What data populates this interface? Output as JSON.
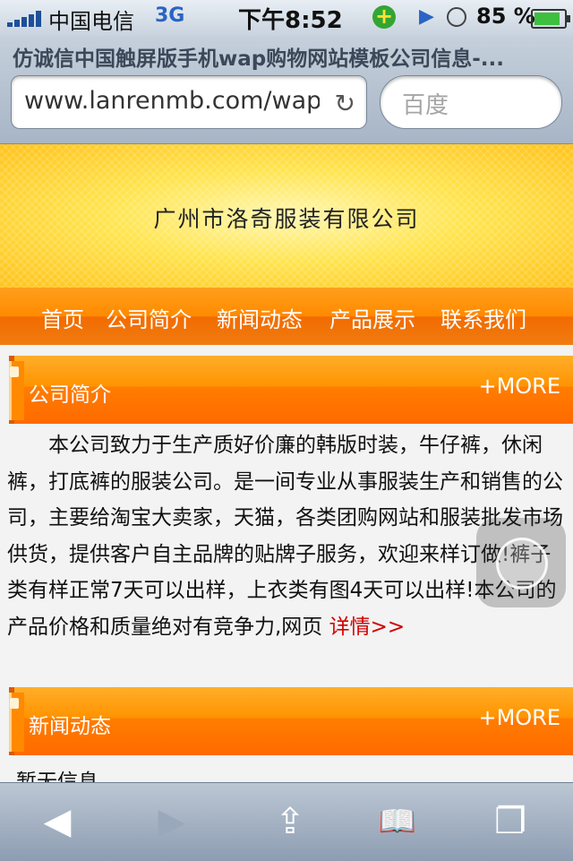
{
  "status_bar": {
    "carrier": "中国电信",
    "network": "3G",
    "time": "下午8:52",
    "battery": "85 %"
  },
  "browser": {
    "page_title": "仿诚信中国触屏版手机wap购物网站模板公司信息-...",
    "url": "www.lanrenmb.com/wap",
    "search_placeholder": "百度"
  },
  "banner": {
    "company_name": "广州市洛奇服装有限公司"
  },
  "nav": {
    "items": [
      "首页",
      "公司简介",
      "新闻动态",
      "产品展示",
      "联系我们"
    ]
  },
  "sections": {
    "about": {
      "title": "公司简介",
      "more": "+MORE",
      "text": "本公司致力于生产质好价廉的韩版时装，牛仔裤，休闲裤，打底裤的服装公司。是一间专业从事服装生产和销售的公司，主要给淘宝大卖家，天猫，各类团购网站和服装批发市场供货，提供客户自主品牌的贴牌子服务，欢迎来样订做!裤子类有样正常7天可以出样，上衣类有图4天可以出样!本公司的产品价格和质量绝对有竞争力,网页 ",
      "detail_link": "详情>>"
    },
    "news": {
      "title": "新闻动态",
      "more": "+MORE",
      "first_item": "暂无信息"
    }
  },
  "toolbar": {
    "back": "◀",
    "forward": "▶",
    "share": "⇪",
    "bookmarks": "📖",
    "tabs": "❐"
  },
  "colors": {
    "accent": "#ff8a00",
    "banner": "#ffd633",
    "link": "#d10000"
  }
}
